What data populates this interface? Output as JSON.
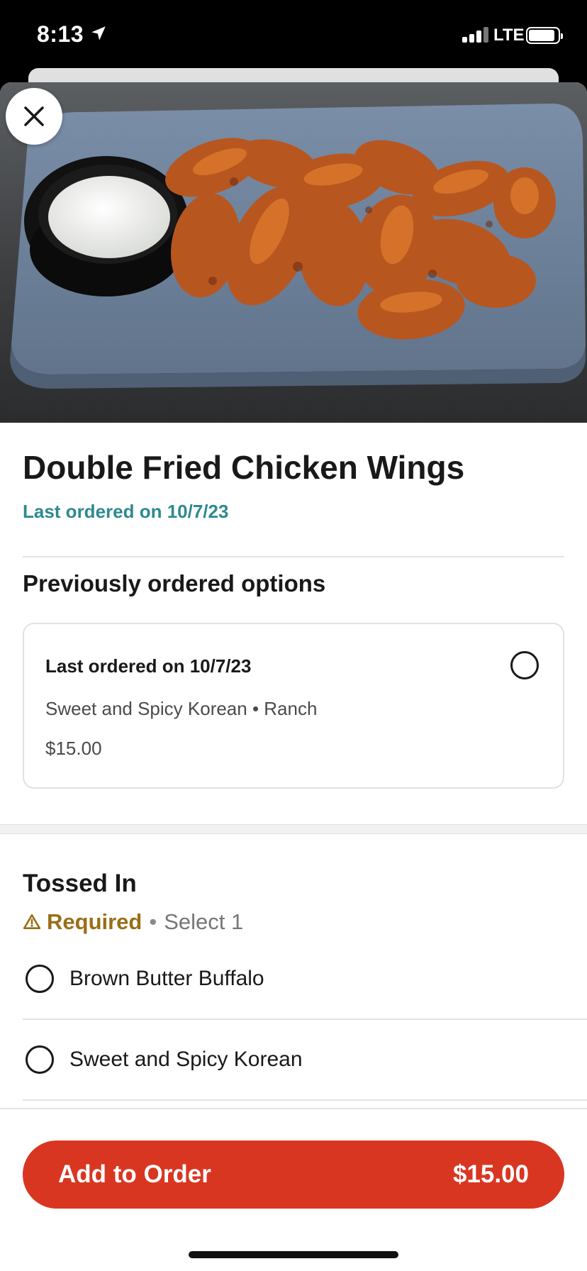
{
  "status_bar": {
    "time": "8:13",
    "network": "LTE",
    "signal_bars": 3,
    "battery_level": 0.85
  },
  "item": {
    "title": "Double Fried Chicken Wings",
    "last_ordered": "Last ordered on 10/7/23"
  },
  "previous_options": {
    "heading": "Previously ordered options",
    "card": {
      "title": "Last ordered on 10/7/23",
      "options": "Sweet and Spicy Korean • Ranch",
      "price": "$15.00"
    }
  },
  "tossed_in": {
    "heading": "Tossed In",
    "required_label": "Required",
    "separator": "•",
    "select_hint": "Select 1",
    "options": [
      {
        "label": "Brown Butter Buffalo"
      },
      {
        "label": "Sweet and Spicy Korean"
      }
    ]
  },
  "cta": {
    "label": "Add to Order",
    "price": "$15.00"
  },
  "colors": {
    "accent": "#d93621",
    "teal": "#2e8a8f",
    "required": "#9a6e18"
  }
}
